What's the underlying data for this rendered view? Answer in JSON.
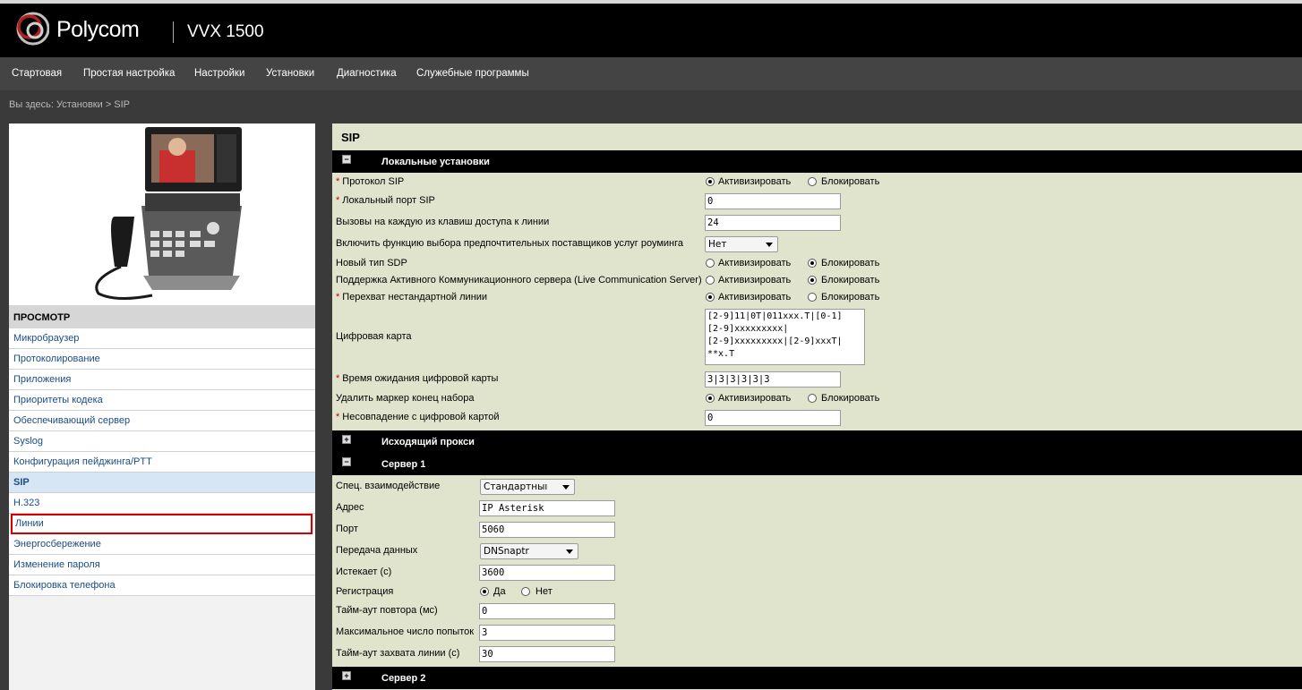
{
  "header": {
    "brand": "Polycom",
    "model": "VVX 1500"
  },
  "nav": [
    "Стартовая",
    "Простая настройка",
    "Настройки",
    "Установки",
    "Диагностика",
    "Служебные программы"
  ],
  "breadcrumb": "Вы здесь: Установки > SIP",
  "sidebar": {
    "heading": "ПРОСМОТР",
    "items": [
      "Микробраузер",
      "Протоколирование",
      "Приложения",
      "Приоритеты кодека",
      "Обеспечивающий сервер",
      "Syslog",
      "Конфигурация пейджинга/PTT",
      "SIP",
      "H.323",
      "Линии",
      "Энергосбережение",
      "Изменение пароля",
      "Блокировка телефона"
    ]
  },
  "main": {
    "title": "SIP",
    "sections": {
      "local": "Локальные установки",
      "proxy": "Исходящий прокси",
      "server1": "Сервер 1",
      "server2": "Сервер 2"
    },
    "local": {
      "sip_protocol": "Протокол SIP",
      "local_port": "Локальный порт SIP",
      "local_port_value": "0",
      "calls_per_key": "Вызовы на каждую из клавиш доступа к линии",
      "calls_per_key_value": "24",
      "roaming": "Включить функцию выбора предпочтительных поставщиков услуг роуминга",
      "roaming_value": "Нет",
      "new_sdp": "Новый тип SDP",
      "lcs": "Поддержка Активного Коммуникационного сервера (Live Communication Server)",
      "intercept": "Перехват нестандартной  линии",
      "digitmap": "Цифровая карта",
      "digitmap_value": "[2-9]11|0T|011xxx.T|[0-1]\n[2-9]xxxxxxxxx|\n[2-9]xxxxxxxxx|[2-9]xxxT|\n**x.T",
      "dm_timeout": "Время ожидания цифровой карты",
      "dm_timeout_value": "3|3|3|3|3|3",
      "remove_eod": "Удалить маркер конец набора",
      "mismatch": "Несовпадение с цифровой картой",
      "mismatch_value": "0",
      "enable": "Активизировать",
      "disable": "Блокировать"
    },
    "server1": {
      "special": "Спец. взаимодействие",
      "special_value": "Стандартныı",
      "address": "Адрес",
      "address_value": "IP Asterisk",
      "port": "Порт",
      "port_value": "5060",
      "transport": "Передача данных",
      "transport_value": "DNSnaptr",
      "expires": "Истекает (с)",
      "expires_value": "3600",
      "register": "Регистрация",
      "yes": "Да",
      "no": "Нет",
      "retry_timeout": "Тайм-аут повтора (мс)",
      "retry_timeout_value": "0",
      "max_retries": "Максимальное число попыток",
      "max_retries_value": "3",
      "line_seize": "Тайм-аут захвата линии (с)",
      "line_seize_value": "30"
    }
  },
  "colors": {
    "accent_outline": "#d40000",
    "main_bg": "#e1e4cc",
    "link": "#1a4c86"
  }
}
